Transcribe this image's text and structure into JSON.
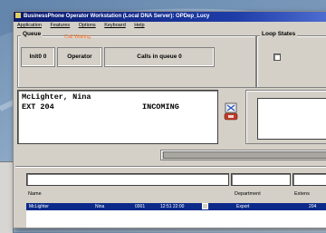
{
  "window": {
    "title": "BusinessPhone Operator Workstation (Local DNA Server): OPDep_Lucy"
  },
  "menu": [
    "Application",
    "Features",
    "Options",
    "Keyboard",
    "Help"
  ],
  "queue": {
    "label": "Queue",
    "hold_status": "Call Waiting",
    "cells": [
      "Init0 0",
      "Operator",
      "Calls in queue 0"
    ]
  },
  "loop_states": {
    "label": "Loop States"
  },
  "call": {
    "name": "McLighter, Nina",
    "ext": "EXT 204",
    "status": "INCOMING"
  },
  "directory": {
    "columns": [
      "Name",
      "Department",
      "Extens"
    ],
    "row": {
      "name": "McLighter",
      "first": "Nina",
      "code": "0001",
      "time": "12:51 22:00",
      "dept": "Export",
      "ext": "204"
    }
  },
  "colors": {
    "title_bar": "#0a1a6e",
    "selection": "#0b2a8a",
    "hold_status": "#ff6a1a",
    "window_face": "#d4d0c8"
  }
}
